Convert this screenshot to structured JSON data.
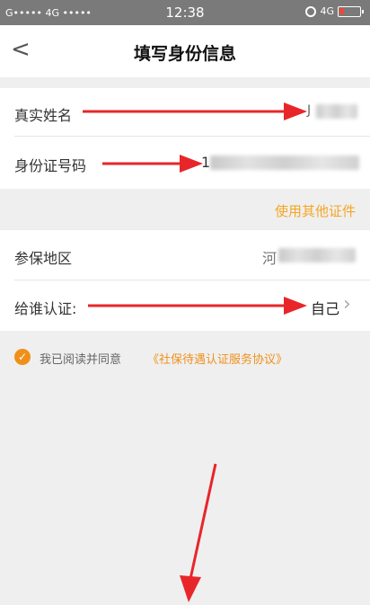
{
  "status_bar": {
    "carrier": "G••••• 4G •••••",
    "time": "12:38",
    "network": "4G"
  },
  "header": {
    "back_icon": "<",
    "title": "填写身份信息"
  },
  "form": {
    "real_name_label": "真实姓名",
    "real_name_value_prefix": "J",
    "id_number_label": "身份证号码",
    "id_number_value_prefix": "1",
    "other_id_link": "使用其他证件",
    "insured_region_label": "参保地区",
    "insured_region_value_prefix": "河",
    "certify_for_label": "给谁认证:",
    "certify_for_value": "自己",
    "chevron": "›"
  },
  "agreement": {
    "check_glyph": "✓",
    "text": "我已阅读并同意",
    "protocol": "《社保待遇认证服务协议》"
  },
  "colors": {
    "accent": "#f5a623",
    "arrow": "#e8262a",
    "status_bar_bg": "#7a7a7a"
  }
}
